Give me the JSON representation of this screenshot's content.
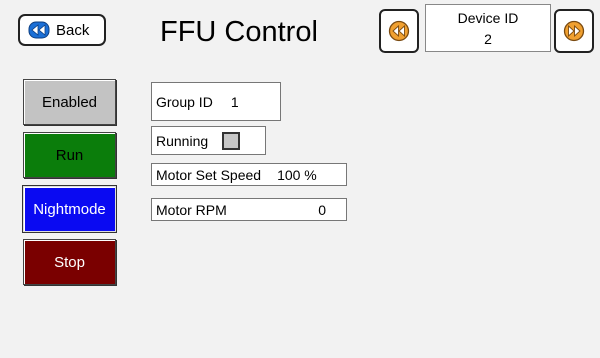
{
  "header": {
    "back_label": "Back",
    "title": "FFU Control",
    "device_id_label": "Device ID",
    "device_id_value": "2"
  },
  "controls": {
    "enabled_label": "Enabled",
    "run_label": "Run",
    "nightmode_label": "Nightmode",
    "stop_label": "Stop"
  },
  "fields": {
    "group_id_label": "Group ID",
    "group_id_value": "1",
    "running_label": "Running",
    "running_checked": false,
    "motor_set_speed_label": "Motor Set Speed",
    "motor_set_speed_value": "100 %",
    "motor_rpm_label": "Motor RPM",
    "motor_rpm_value": "0"
  },
  "icons": {
    "back": "rewind-icon",
    "prev_device": "rewind-icon",
    "next_device": "fast-forward-icon"
  },
  "colors": {
    "enabled": "#c3c3c3",
    "run": "#0b7d0b",
    "nightmode": "#0a0af2",
    "stop": "#7a0000",
    "icon_blue": "#1b6fd6",
    "icon_orange": "#f0a030"
  }
}
